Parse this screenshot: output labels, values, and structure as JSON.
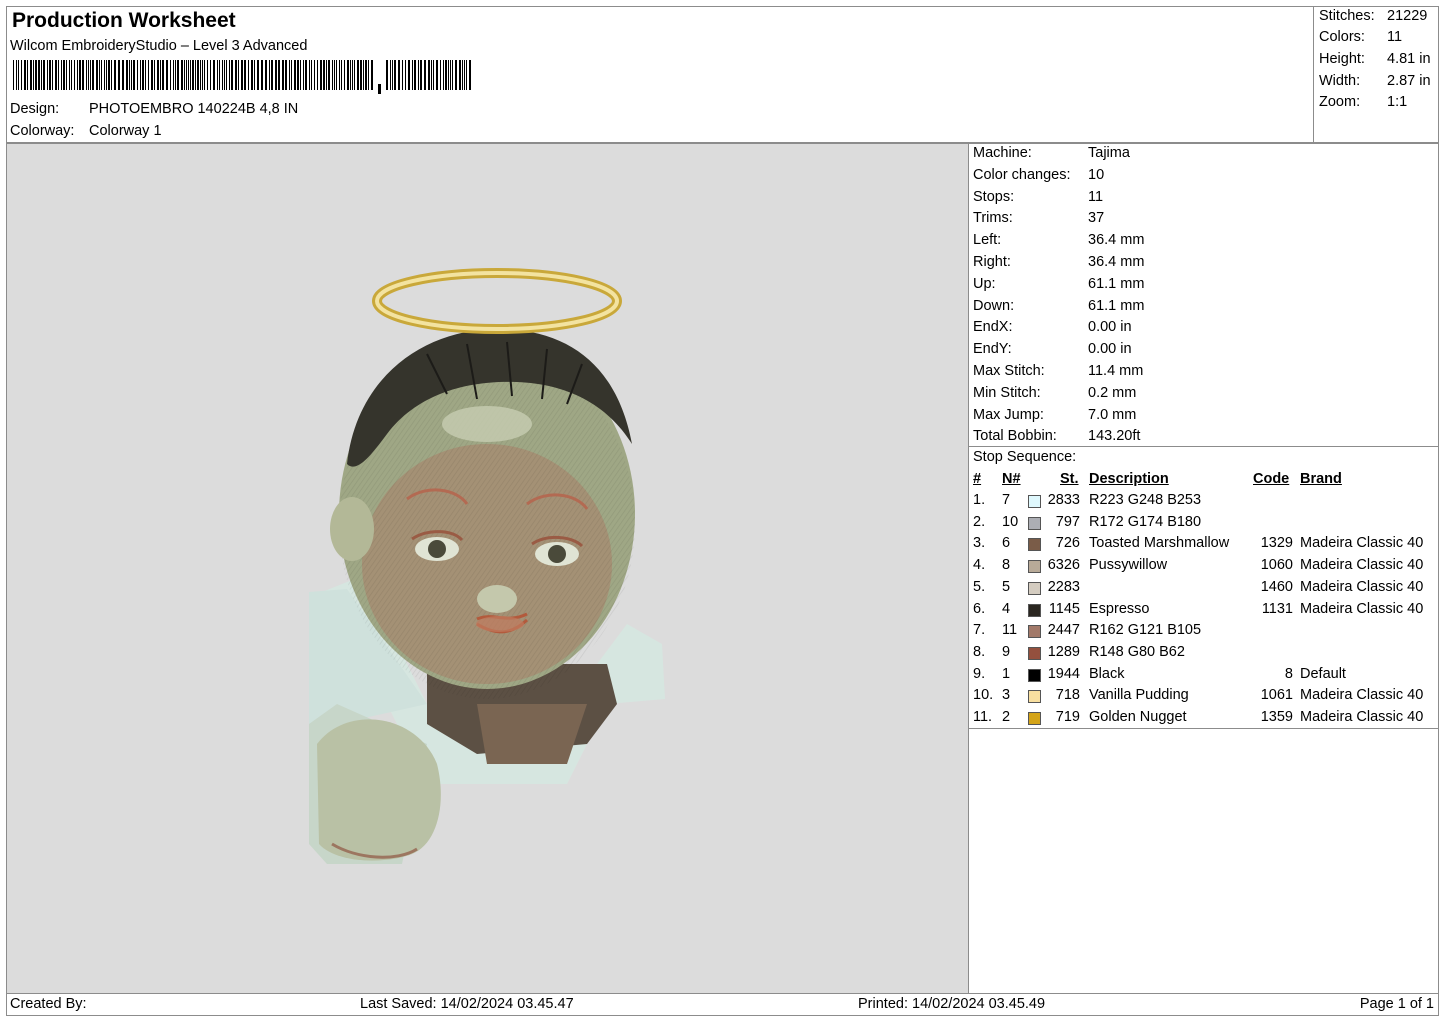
{
  "header": {
    "title": "Production Worksheet",
    "software": "Wilcom EmbroideryStudio – Level 3 Advanced",
    "design_label": "Design:",
    "design_value": "PHOTOEMBRO 140224B 4,8 IN",
    "colorway_label": "Colorway:",
    "colorway_value": "Colorway 1"
  },
  "stats": [
    {
      "label": "Stitches:",
      "value": "21229"
    },
    {
      "label": "Colors:",
      "value": "11"
    },
    {
      "label": "Height:",
      "value": "4.81 in"
    },
    {
      "label": "Width:",
      "value": "2.87 in"
    },
    {
      "label": "Zoom:",
      "value": "1:1"
    }
  ],
  "machine_info": [
    {
      "label": "Machine:",
      "value": "Tajima"
    },
    {
      "label": "Color changes:",
      "value": "10"
    },
    {
      "label": "Stops:",
      "value": "11"
    },
    {
      "label": "Trims:",
      "value": "37"
    },
    {
      "label": "Left:",
      "value": "36.4 mm"
    },
    {
      "label": "Right:",
      "value": "36.4 mm"
    },
    {
      "label": "Up:",
      "value": "61.1 mm"
    },
    {
      "label": "Down:",
      "value": "61.1 mm"
    },
    {
      "label": "EndX:",
      "value": "0.00 in"
    },
    {
      "label": "EndY:",
      "value": "0.00 in"
    },
    {
      "label": "Max Stitch:",
      "value": "11.4 mm"
    },
    {
      "label": "Min Stitch:",
      "value": "0.2 mm"
    },
    {
      "label": "Max Jump:",
      "value": "7.0 mm"
    },
    {
      "label": "Total Bobbin:",
      "value": "143.20ft"
    }
  ],
  "sequence": {
    "title": "Stop Sequence:",
    "headers": {
      "idx": "#",
      "n": "N#",
      "st": "St.",
      "desc": "Description",
      "code": "Code",
      "brand": "Brand"
    },
    "rows": [
      {
        "idx": "1.",
        "n": "7",
        "color": "#DFF8FD",
        "st": "2833",
        "desc": "R223 G248 B253",
        "code": "",
        "brand": ""
      },
      {
        "idx": "2.",
        "n": "10",
        "color": "#ACAEB4",
        "st": "797",
        "desc": "R172 G174 B180",
        "code": "",
        "brand": ""
      },
      {
        "idx": "3.",
        "n": "6",
        "color": "#7A5C48",
        "st": "726",
        "desc": "Toasted Marshmallow",
        "code": "1329",
        "brand": "Madeira Classic 40"
      },
      {
        "idx": "4.",
        "n": "8",
        "color": "#B8AA98",
        "st": "6326",
        "desc": "Pussywillow",
        "code": "1060",
        "brand": "Madeira Classic 40"
      },
      {
        "idx": "5.",
        "n": "5",
        "color": "#D4CCC0",
        "st": "2283",
        "desc": "",
        "code": "1460",
        "brand": "Madeira Classic 40"
      },
      {
        "idx": "6.",
        "n": "4",
        "color": "#2A2620",
        "st": "1145",
        "desc": "Espresso",
        "code": "1131",
        "brand": "Madeira Classic 40"
      },
      {
        "idx": "7.",
        "n": "11",
        "color": "#A27969",
        "st": "2447",
        "desc": "R162 G121 B105",
        "code": "",
        "brand": ""
      },
      {
        "idx": "8.",
        "n": "9",
        "color": "#94503E",
        "st": "1289",
        "desc": "R148 G80 B62",
        "code": "",
        "brand": ""
      },
      {
        "idx": "9.",
        "n": "1",
        "color": "#000000",
        "st": "1944",
        "desc": "Black",
        "code": "8",
        "brand": "Default"
      },
      {
        "idx": "10.",
        "n": "3",
        "color": "#F8DFA0",
        "st": "718",
        "desc": "Vanilla Pudding",
        "code": "1061",
        "brand": "Madeira Classic 40"
      },
      {
        "idx": "11.",
        "n": "2",
        "color": "#D4A418",
        "st": "719",
        "desc": "Golden Nugget",
        "code": "1359",
        "brand": "Madeira Classic 40"
      }
    ]
  },
  "footer": {
    "created_by": "Created By:",
    "last_saved": "Last Saved: 14/02/2024 03.45.47",
    "printed": "Printed: 14/02/2024 03.45.49",
    "page": "Page 1 of 1"
  }
}
